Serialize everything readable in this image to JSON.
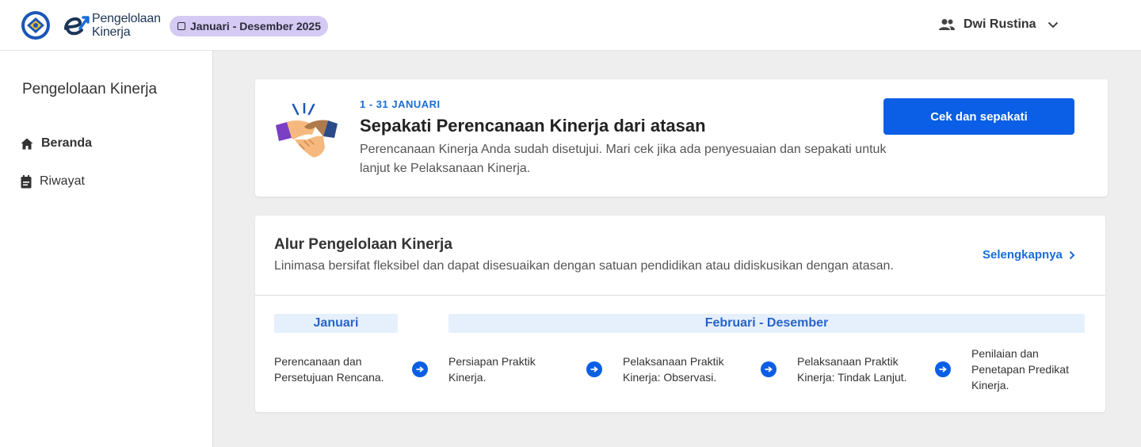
{
  "header": {
    "logo_text_line1": "Pengelolaan",
    "logo_text_line2": "Kinerja",
    "period_badge": "Januari - Desember 2025",
    "user_name": "Dwi Rustina"
  },
  "sidebar": {
    "title": "Pengelolaan Kinerja",
    "items": [
      {
        "label": "Beranda",
        "icon": "home-icon",
        "active": true
      },
      {
        "label": "Riwayat",
        "icon": "calendar-icon",
        "active": false
      }
    ]
  },
  "task_card": {
    "date_range": "1 - 31 JANUARI",
    "title": "Sepakati Perencanaan Kinerja dari atasan",
    "description": "Perencanaan Kinerja Anda sudah disetujui. Mari cek jika ada penyesuaian dan sepakati untuk lanjut ke Pelaksanaan Kinerja.",
    "button_label": "Cek dan sepakati",
    "illustration": "handshake-icon"
  },
  "flow_card": {
    "title": "Alur Pengelolaan Kinerja",
    "subtitle": "Linimasa bersifat fleksibel dan dapat disesuaikan dengan satuan pendidikan atau didiskusikan dengan atasan.",
    "link_label": "Selengkapnya",
    "phases": [
      {
        "label": "Januari"
      },
      {
        "label": "Februari - Desember"
      }
    ],
    "steps": [
      {
        "label": "Perencanaan dan Persetujuan Rencana."
      },
      {
        "label": "Persiapan Praktik Kinerja."
      },
      {
        "label": "Pelaksanaan Praktik Kinerja: Observasi."
      },
      {
        "label": "Pelaksanaan Praktik Kinerja: Tindak Lanjut."
      },
      {
        "label": "Penilaian dan Penetapan Predikat Kinerja."
      }
    ]
  },
  "colors": {
    "primary": "#0b5fe6",
    "link": "#1a6dd6",
    "badge_bg": "#d4caf3",
    "phase_bg": "#e6f0fd",
    "page_bg": "#eeeeee"
  }
}
